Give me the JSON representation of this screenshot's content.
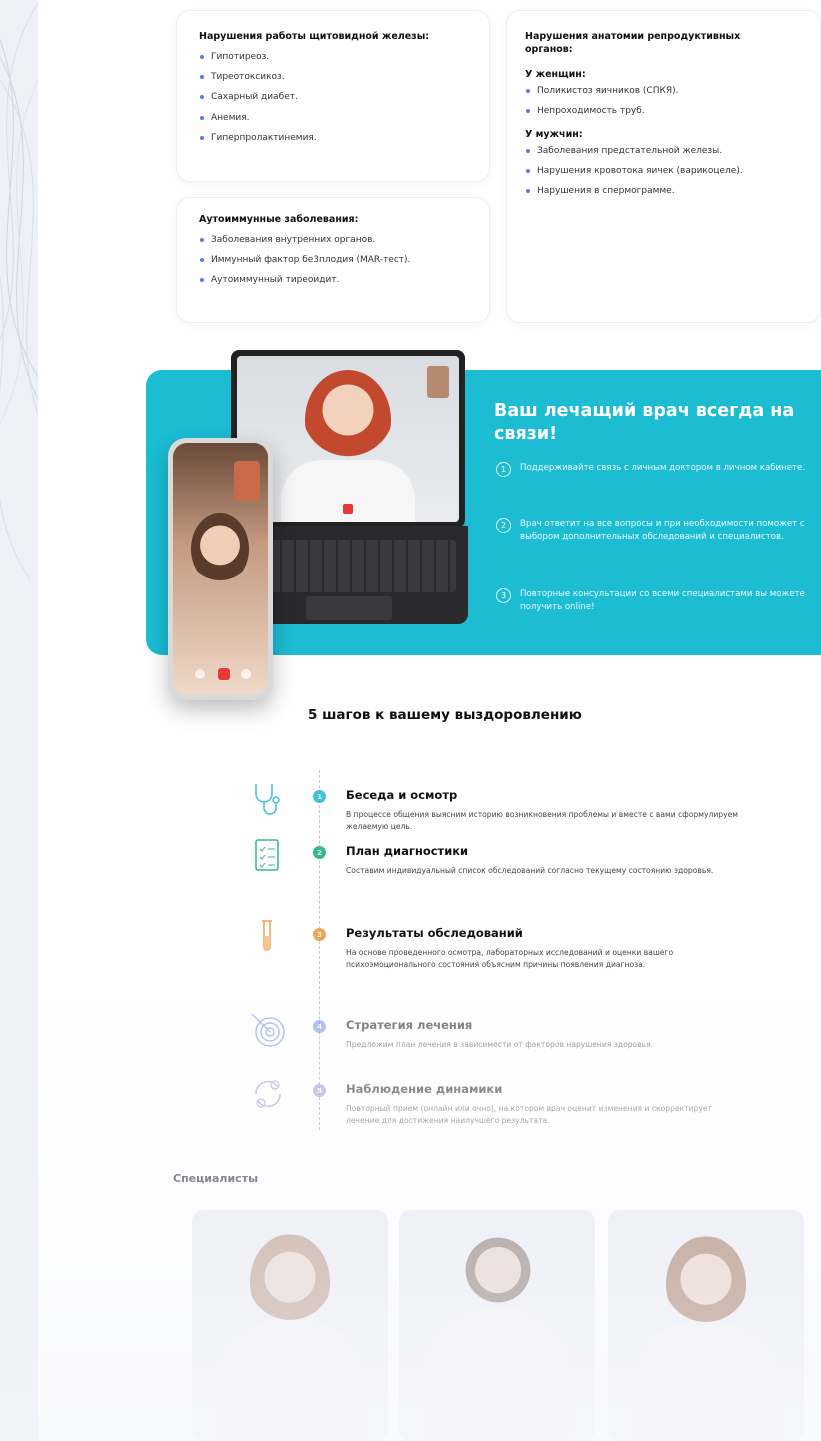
{
  "conditions": {
    "thyroid": {
      "title": "Нарушения работы щитовидной железы:",
      "items": [
        "Гипотиреоз.",
        "Тиреотоксикоз.",
        "Сахарный диабет.",
        "Анемия.",
        "Гиперпролактинемия."
      ]
    },
    "autoimmune": {
      "title": "Аутоиммунные заболевания:",
      "items": [
        "Заболевания внутренних органов.",
        "Иммунный фактор бе3плодия (MAR-тест).",
        "Аутоиммунный тиреоидит."
      ]
    },
    "anatomy": {
      "title": "Нарушения анатомии репродуктивных органов:",
      "women_label": "У женщин:",
      "women": [
        "Поликистоз яичников (СПКЯ).",
        "Непроходимость труб."
      ],
      "men_label": "У мужчин:",
      "men": [
        "Заболевания предстательной железы.",
        "Нарушения кровотока яичек (варикоцеле).",
        "Нарушения в спермограмме."
      ]
    }
  },
  "doctor_banner": {
    "title": "Ваш лечащий врач всегда на связи!",
    "features": [
      {
        "num": "1",
        "text": "Поддерживайте связь с личным доктором в личном кабинете."
      },
      {
        "num": "2",
        "text": "Врач ответит на все вопросы и при необходимости поможет с выбором дополнительных обследований и специалистов."
      },
      {
        "num": "3",
        "text": "Повторные консультации со всеми специалистами вы можете получить online!"
      }
    ],
    "accent_color": "#1cbcd3"
  },
  "steps": {
    "title": "5 шагов к вашему выздоровлению",
    "items": [
      {
        "num": "1",
        "title": "Беседа и осмотр",
        "text": "В процессе общения выясним историю возникновения проблемы и вместе с вами сформулируем желаемую цель.",
        "color": "#3ec3d8",
        "icon": "stethoscope-icon"
      },
      {
        "num": "2",
        "title": "План диагностики",
        "text": "Составим индивидуальный список обследований согласно текущему состоянию здоровья.",
        "color": "#33b98a",
        "icon": "checklist-icon"
      },
      {
        "num": "3",
        "title": "Результаты обследований",
        "text": "На основе проведенного осмотра, лабораторных исследований и оценки вашего психоэмоционального состояния объясним причины появления диагноза.",
        "color": "#f0a25a",
        "icon": "test-tube-icon"
      },
      {
        "num": "4",
        "title": "Стратегия лечения",
        "text": "Предложим план лечения в зависимости от факторов нарушения здоровья.",
        "color": "#6b8df0",
        "icon": "target-icon"
      },
      {
        "num": "5",
        "title": "Наблюдение динамики",
        "text": "Повторный прием (онлайн или очно), на котором врач оценит изменения и скорректирует лечение для достижения наилучшего результата.",
        "color": "#9b86e0",
        "icon": "cycle-icon"
      }
    ]
  },
  "specialists": {
    "title": "Специалисты"
  }
}
